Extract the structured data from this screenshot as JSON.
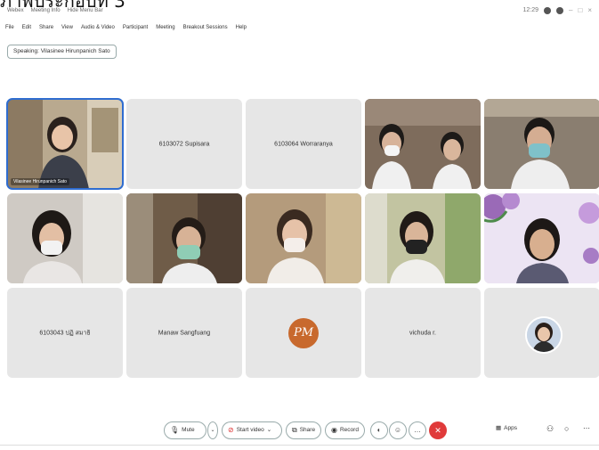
{
  "caption": "ภาพประกอบที่ 3",
  "titlebar": {
    "app": "Webex",
    "meeting_info": "Meeting Info",
    "hide_menu": "Hide Menu Bar",
    "time": "12:29"
  },
  "menu": [
    "File",
    "Edit",
    "Share",
    "View",
    "Audio & Video",
    "Participant",
    "Meeting",
    "Breakout Sessions",
    "Help"
  ],
  "speaking": "Speaking: Vilasinee Hirunpanich Sato",
  "tiles": {
    "t1_name": "Vilasinee Hirunpanich Sato",
    "t2_name": "6103072 Supisara",
    "t3_name": "6103064 Worraranya",
    "t11_name": "6103043 ปฏิ สมาธิ",
    "t12_name": "Manaw Sangfuang",
    "t13_initials": "PM",
    "t14_name": "vichuda r."
  },
  "controls": {
    "mute": "Mute",
    "start_video": "Start video",
    "share": "Share",
    "record": "Record",
    "apps": "Apps"
  },
  "colors": {
    "end_call": "#e03a3a",
    "active_outline": "#2f6dd0",
    "initials_bg": "#c8692d"
  }
}
